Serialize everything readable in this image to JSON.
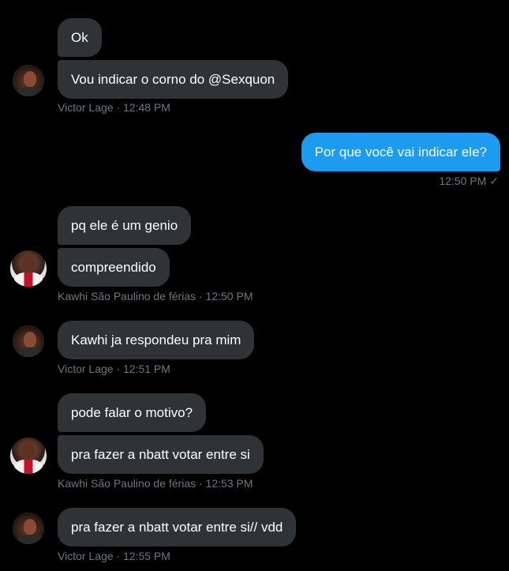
{
  "colors": {
    "background": "#000000",
    "incoming_bubble": "#2f3336",
    "outgoing_bubble": "#1d9bf0",
    "meta_text": "#6e767d",
    "text": "#ffffff"
  },
  "messages": {
    "m1": "Ok",
    "m2": "Vou indicar o corno do @Sexquon",
    "m3": "Por que você vai indicar ele?",
    "m4": "pq ele é um genio",
    "m5": "compreendido",
    "m6": "Kawhi ja respondeu pra mim",
    "m7": "pode falar o motivo?",
    "m8": "pra fazer a nbatt votar entre si",
    "m9": "pra fazer a nbatt votar entre si// vdd"
  },
  "meta": {
    "g1": "Victor Lage · 12:48 PM",
    "g2": "12:50 PM",
    "g2_check": "✓",
    "g3": "Kawhi São Paulino de férias · 12:50 PM",
    "g4": "Victor Lage · 12:51 PM",
    "g5": "Kawhi São Paulino de férias · 12:53 PM",
    "g6": "Victor Lage · 12:55 PM"
  },
  "avatars": {
    "victor": "victor-lage-avatar",
    "kawhi": "kawhi-avatar"
  }
}
